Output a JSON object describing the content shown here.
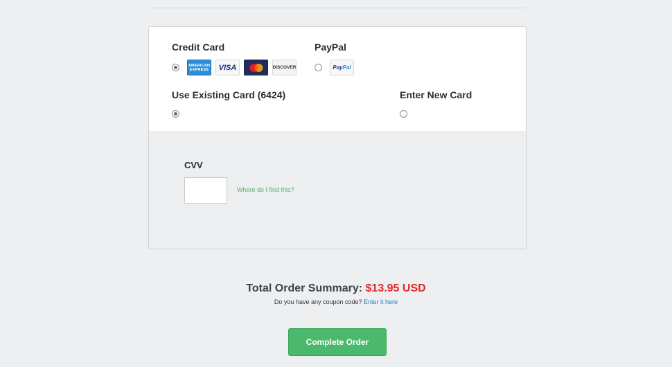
{
  "payment_methods": {
    "credit_card": {
      "label": "Credit Card",
      "selected": true,
      "card_logos": [
        {
          "icon": "amex-logo-icon",
          "text": "AMERICAN EXPRESS"
        },
        {
          "icon": "visa-logo-icon",
          "text": "VISA"
        },
        {
          "icon": "mastercard-logo-icon",
          "text": ""
        },
        {
          "icon": "discover-logo-icon",
          "text": "DISCOVER"
        }
      ]
    },
    "paypal": {
      "label": "PayPal",
      "selected": false,
      "logo_text_1": "Pay",
      "logo_text_2": "Pal"
    }
  },
  "card_choice": {
    "existing": {
      "label": "Use Existing Card (6424)",
      "selected": true
    },
    "new": {
      "label": "Enter New Card",
      "selected": false
    }
  },
  "cvv": {
    "label": "CVV",
    "value": "",
    "help_link": "Where do I find this?"
  },
  "summary": {
    "total_label": "Total Order Summary:",
    "total_amount": "$13.95 USD",
    "coupon_prompt": "Do you have any coupon code?",
    "coupon_link": "Enter it here"
  },
  "actions": {
    "complete_label": "Complete Order"
  },
  "colors": {
    "accent_green": "#4ab96b",
    "price_red": "#e0282c",
    "link_blue": "#2a7fc0",
    "help_green": "#56b56f"
  }
}
